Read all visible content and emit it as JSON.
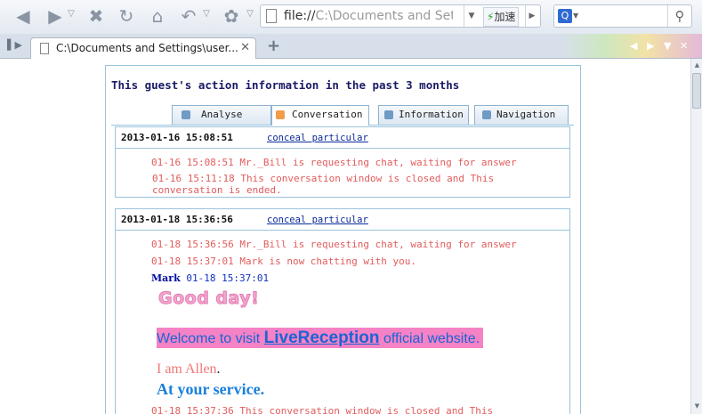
{
  "browser": {
    "address": {
      "prefix": "file://",
      "path": "C:\\Documents and Setti",
      "speed_label": "加速"
    },
    "tab": {
      "label": "C:\\Documents and Settings\\user..."
    },
    "new_tab_symbol": "+"
  },
  "page": {
    "heading": "This guest's action information in the past 3 months",
    "tabs": [
      {
        "label": "Analyse"
      },
      {
        "label": "Conversation",
        "active": true
      },
      {
        "label": "Information"
      },
      {
        "label": "Navigation"
      }
    ],
    "conversations": [
      {
        "date": "2013-01-16 15:08:51",
        "toggle_label": "conceal particular",
        "entries": [
          "01-16 15:08:51  Mr._Bill is requesting chat, waiting for answer",
          "01-16 15:11:18  This conversation window is closed and This conversation is ended."
        ]
      },
      {
        "date": "2013-01-18 15:36:56",
        "toggle_label": "conceal particular",
        "entries": [
          "01-18 15:36:56  Mr._Bill is requesting chat, waiting for answer",
          "01-18 15:37:01  Mark is now chatting with you."
        ],
        "message": {
          "sender": "Mark",
          "time": "01-18 15:37:01",
          "greeting": "Good day!",
          "welcome_prefix": "Welcome to visit ",
          "welcome_brand": "LiveReception",
          "welcome_suffix": " official website.",
          "intro": "I am Allen",
          "intro_end": ".",
          "service": "At your service."
        },
        "closing": "01-18 15:37:36  This conversation window is closed and This"
      }
    ]
  }
}
